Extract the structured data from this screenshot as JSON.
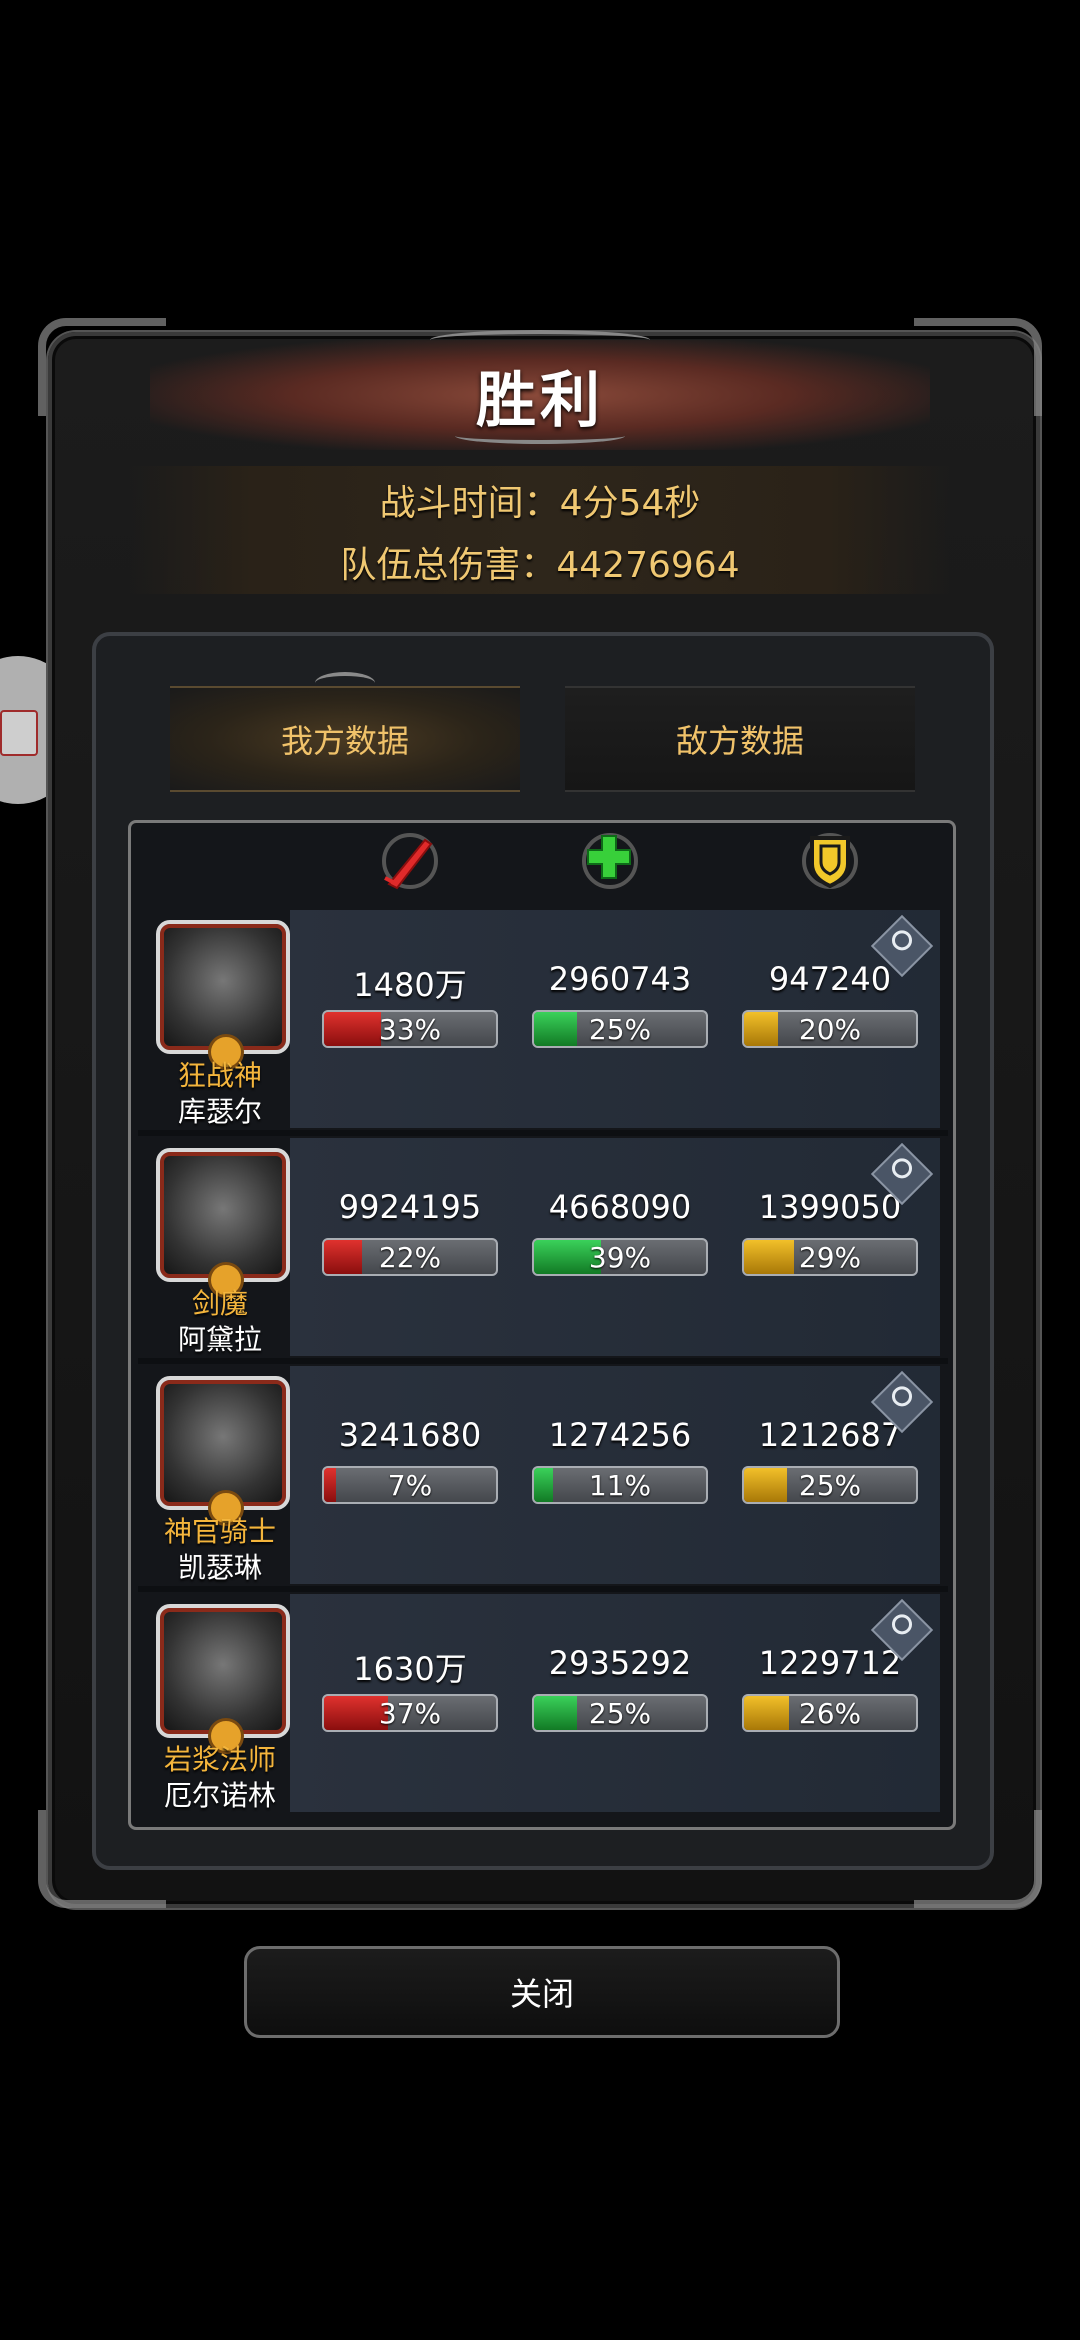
{
  "title": "胜利",
  "battle_time": "战斗时间：4分54秒",
  "team_damage": "队伍总伤害：44276964",
  "tabs": {
    "ours": "我方数据",
    "enemy": "敌方数据"
  },
  "columns": [
    {
      "icon": "sword-icon",
      "color": "#e02a2a"
    },
    {
      "icon": "heal-cross-icon",
      "color": "#38d03a"
    },
    {
      "icon": "shield-icon",
      "color": "#f2c82a"
    }
  ],
  "rows": [
    {
      "class": "狂战神",
      "name": "库瑟尔",
      "damage": "1480万",
      "damage_pct": "33%",
      "damage_frac": 0.33,
      "heal": "2960743",
      "heal_pct": "25%",
      "heal_frac": 0.25,
      "tank": "947240",
      "tank_pct": "20%",
      "tank_frac": 0.2
    },
    {
      "class": "剑魔",
      "name": "阿黛拉",
      "damage": "9924195",
      "damage_pct": "22%",
      "damage_frac": 0.22,
      "heal": "4668090",
      "heal_pct": "39%",
      "heal_frac": 0.39,
      "tank": "1399050",
      "tank_pct": "29%",
      "tank_frac": 0.29
    },
    {
      "class": "神官骑士",
      "name": "凯瑟琳",
      "damage": "3241680",
      "damage_pct": "7%",
      "damage_frac": 0.07,
      "heal": "1274256",
      "heal_pct": "11%",
      "heal_frac": 0.11,
      "tank": "1212687",
      "tank_pct": "25%",
      "tank_frac": 0.25
    },
    {
      "class": "岩浆法师",
      "name": "厄尔诺林",
      "damage": "1630万",
      "damage_pct": "37%",
      "damage_frac": 0.37,
      "heal": "2935292",
      "heal_pct": "25%",
      "heal_frac": 0.25,
      "tank": "1229712",
      "tank_pct": "26%",
      "tank_frac": 0.26
    }
  ],
  "close_label": "关闭"
}
